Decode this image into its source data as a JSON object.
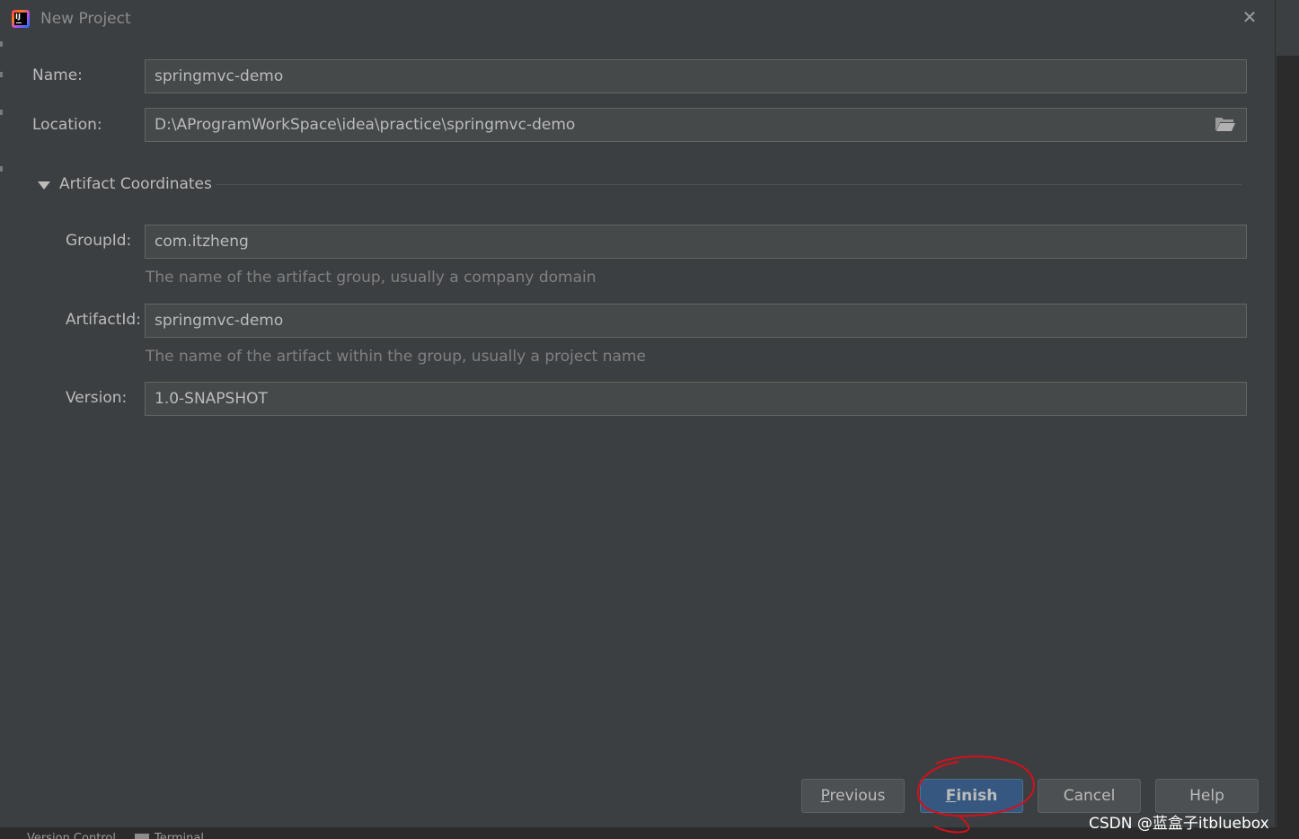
{
  "window": {
    "title": "New Project"
  },
  "form": {
    "name_label": "Name:",
    "name_value": "springmvc-demo",
    "location_label": "Location:",
    "location_value": "D:\\AProgramWorkSpace\\idea\\practice\\springmvc-demo"
  },
  "section": {
    "label": "Artifact Coordinates",
    "expanded": true
  },
  "artifact": {
    "groupid_label": "GroupId:",
    "groupid_value": "com.itzheng",
    "groupid_hint": "The name of the artifact group, usually a company domain",
    "artifactid_label": "ArtifactId:",
    "artifactid_value": "springmvc-demo",
    "artifactid_hint": "The name of the artifact within the group, usually a project name",
    "version_label": "Version:",
    "version_value": "1.0-SNAPSHOT"
  },
  "buttons": {
    "previous_mnemonic": "P",
    "previous_rest": "revious",
    "finish_mnemonic": "F",
    "finish_rest": "inish",
    "cancel": "Cancel",
    "help": "Help"
  },
  "bottom_bar": {
    "left_text": "Version Control",
    "terminal_text": "Terminal"
  },
  "watermark": "CSDN @蓝盒子itbluebox",
  "colors": {
    "annotation_circle": "#d3101c",
    "primary_button": "#365880",
    "background": "#3c3f41"
  }
}
